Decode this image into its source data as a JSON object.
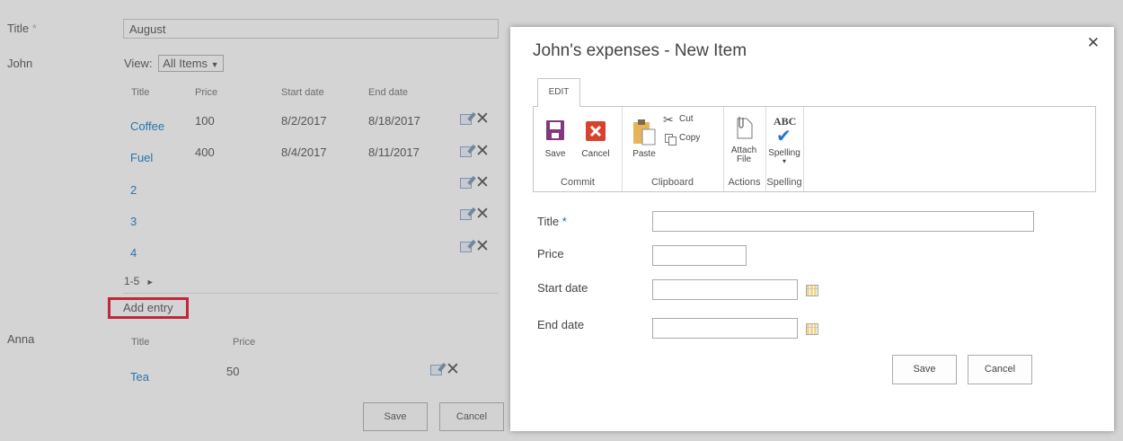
{
  "background": {
    "title_label": "Title",
    "title_required": "*",
    "title_value": "August",
    "john_label": "John",
    "view_label": "View:",
    "view_value": "All Items",
    "view_arrow": "▼",
    "john_headers": [
      "Title",
      "Price",
      "Start date",
      "End date"
    ],
    "john_rows": [
      {
        "title": "Coffee",
        "price": "100",
        "start": "8/2/2017",
        "end": "8/18/2017"
      },
      {
        "title": "Fuel",
        "price": "400",
        "start": "8/4/2017",
        "end": "8/11/2017"
      },
      {
        "title": "2",
        "price": "",
        "start": "",
        "end": ""
      },
      {
        "title": "3",
        "price": "",
        "start": "",
        "end": ""
      },
      {
        "title": "4",
        "price": "",
        "start": "",
        "end": ""
      }
    ],
    "pager": "1-5",
    "pager_arrow": "►",
    "add_entry": "Add entry",
    "anna_label": "Anna",
    "anna_headers": [
      "Title",
      "Price"
    ],
    "anna_rows": [
      {
        "title": "Tea",
        "price": "50"
      }
    ],
    "save_label": "Save",
    "cancel_label": "Cancel",
    "delete_glyph": "✕"
  },
  "dialog": {
    "title": "John's expenses - New Item",
    "close_glyph": "✕",
    "tab": "EDIT",
    "ribbon": {
      "commit": {
        "label": "Commit",
        "save": "Save",
        "cancel": "Cancel"
      },
      "clipboard": {
        "label": "Clipboard",
        "paste": "Paste",
        "cut": "Cut",
        "copy": "Copy"
      },
      "actions": {
        "label": "Actions",
        "attach_line1": "Attach",
        "attach_line2": "File"
      },
      "spelling": {
        "label": "Spelling",
        "abc": "ABC",
        "spelling": "Spelling",
        "check": "✔",
        "arrow": "▾"
      }
    },
    "fields": {
      "title_label": "Title",
      "required": "*",
      "price_label": "Price",
      "start_label": "Start date",
      "end_label": "End date",
      "title_value": "",
      "price_value": "",
      "start_value": "",
      "end_value": ""
    },
    "save_label": "Save",
    "cancel_label": "Cancel"
  },
  "colors": {
    "link": "#0072c6",
    "highlight_box": "#e3001b",
    "save_icon": "#80397b",
    "cancel_icon": "#d9412d",
    "check": "#2b73c4"
  }
}
